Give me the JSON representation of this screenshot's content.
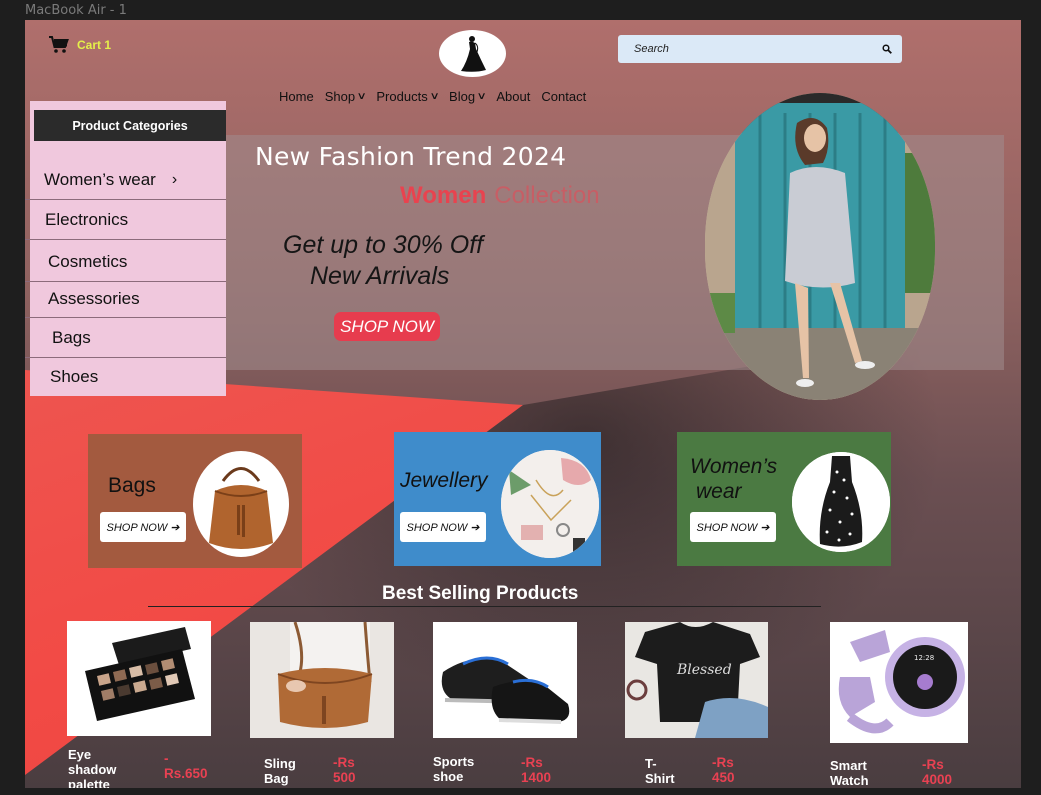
{
  "canvas_label": "MacBook Air - 1",
  "header": {
    "cart_label": "Cart 1",
    "search_placeholder": "Search"
  },
  "nav": [
    {
      "label": "Home",
      "dropdown": false
    },
    {
      "label": "Shop",
      "dropdown": true
    },
    {
      "label": "Products",
      "dropdown": true
    },
    {
      "label": "Blog",
      "dropdown": true
    },
    {
      "label": "About",
      "dropdown": false
    },
    {
      "label": "Contact",
      "dropdown": false
    }
  ],
  "categories": {
    "heading": "Product Categories",
    "items": [
      "Women’s wear",
      "Electronics",
      "Cosmetics",
      "Assessories",
      "Bags",
      "Shoes"
    ],
    "expand_arrow": "›"
  },
  "hero": {
    "title": "New Fashion Trend 2024",
    "sub_highlight": "Women",
    "sub_rest": "Collection",
    "offer_line1": "Get up to 30% Off",
    "offer_line2": "New Arrivals",
    "button": "SHOP NOW"
  },
  "promo_cards": [
    {
      "title": "Bags",
      "button": "SHOP NOW ➔",
      "bg": "#a35a3f"
    },
    {
      "title": "Jewellery",
      "button": "SHOP NOW ➔",
      "bg": "#3f8ccb"
    },
    {
      "title_line1": "Women’s",
      "title_line2": "wear",
      "button": "SHOP NOW ➔",
      "bg": "#4b7a42"
    }
  ],
  "best_selling": {
    "heading": "Best Selling Products",
    "products": [
      {
        "name_line1": "Eye shadow",
        "name_line2": "palette",
        "price": "-Rs.650"
      },
      {
        "name": "Sling Bag",
        "price": "-Rs 500"
      },
      {
        "name": "Sports shoe",
        "price": "-Rs 1400"
      },
      {
        "name": "T-Shirt",
        "price": "-Rs 450"
      },
      {
        "name": "Smart Watch",
        "price": "-Rs 4000"
      }
    ]
  },
  "colors": {
    "accent_red": "#e73c4e",
    "cart_yellow": "#e4f04a",
    "category_panel": "#f0c8dd",
    "search_bg": "#dbe9f7"
  }
}
